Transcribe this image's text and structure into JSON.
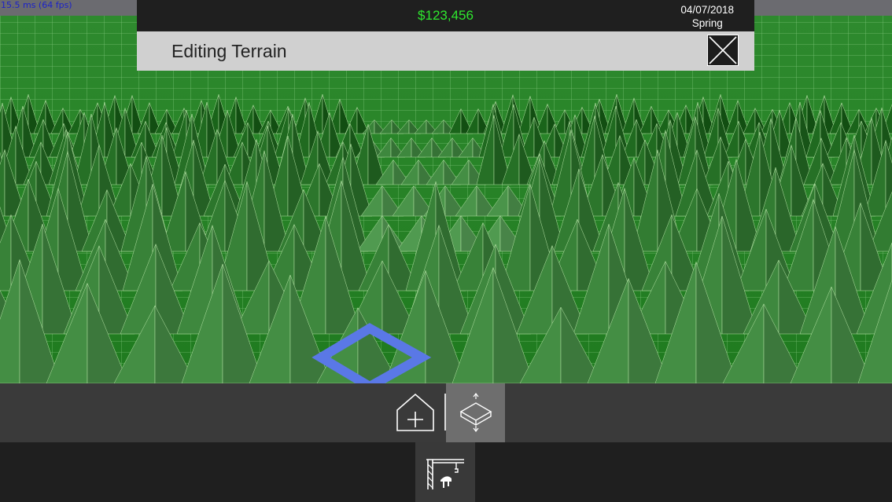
{
  "hud": {
    "fps": "15.5 ms (64 fps)",
    "money": "$123,456",
    "date": "04/07/2018",
    "season": "Spring"
  },
  "edit_panel": {
    "title": "Editing Terrain"
  },
  "icons": {
    "close": "close-x-icon",
    "add_building": "house-plus-icon",
    "terrain_tool": "terrain-raise-lower-icon",
    "construction": "crane-construction-icon"
  },
  "colors": {
    "money": "#2ee82e",
    "terrain_grass": "#2f8f2f",
    "terrain_peak": "#1b5a1b",
    "selection": "#5a78e6",
    "fps_text": "#1c22c8"
  }
}
